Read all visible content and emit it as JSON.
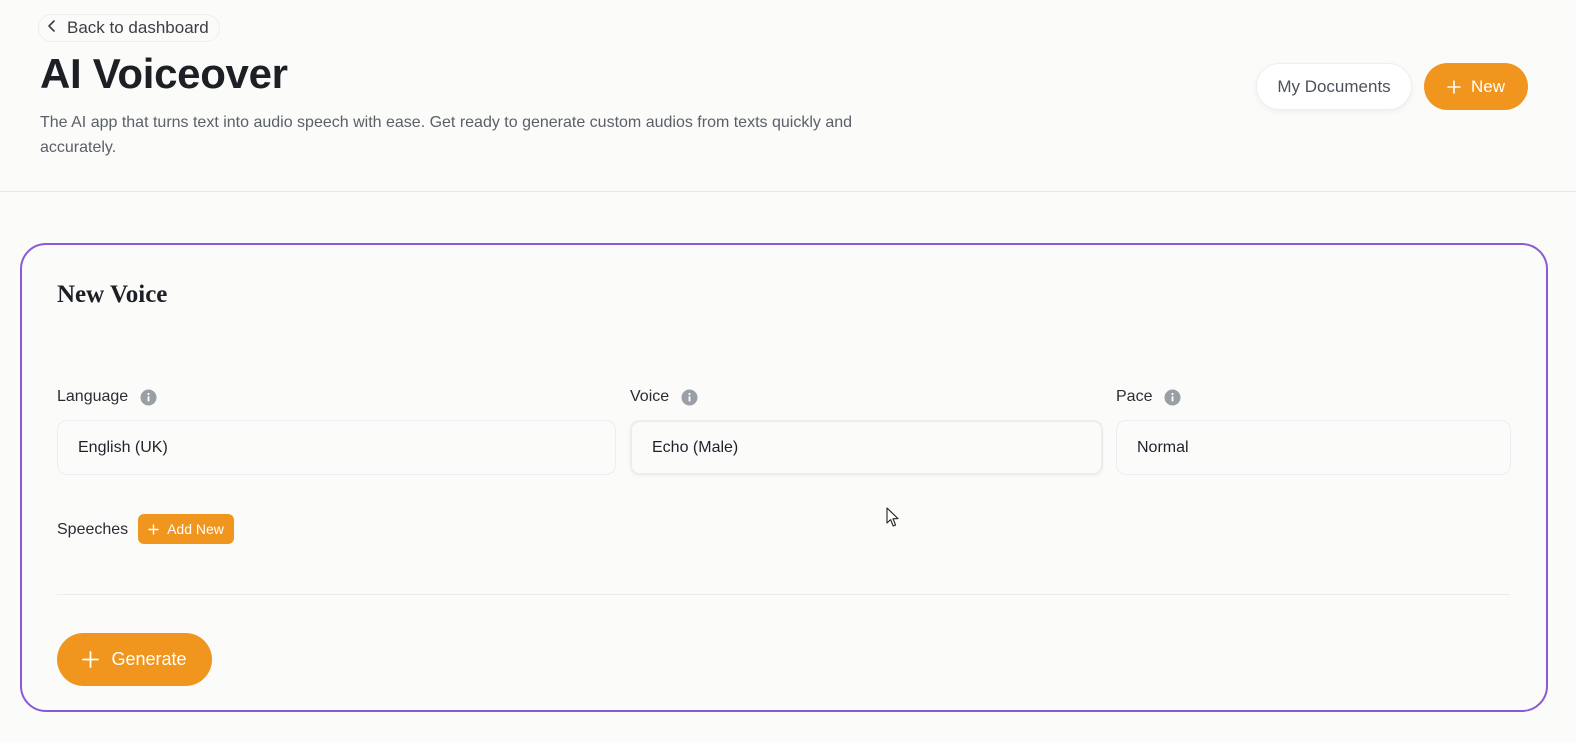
{
  "header": {
    "back_label": "Back to dashboard",
    "title": "AI Voiceover",
    "description": "The AI app that turns text into audio speech with ease. Get ready to generate custom audios from texts quickly and accurately.",
    "my_documents_label": "My Documents",
    "new_label": "New"
  },
  "form": {
    "title": "New Voice",
    "fields": [
      {
        "label": "Language",
        "value": "English (UK)",
        "icon": "info-icon"
      },
      {
        "label": "Voice",
        "value": "Echo (Male)",
        "icon": "info-icon"
      },
      {
        "label": "Pace",
        "value": "Normal",
        "icon": "info-icon"
      }
    ],
    "speeches_label": "Speeches",
    "add_new_label": "Add New",
    "generate_label": "Generate"
  },
  "colors": {
    "accent": "#f0961f",
    "card_border": "#8a5ad6",
    "text_primary": "#1c1f24",
    "text_muted": "#5b6068"
  },
  "icons": [
    "chevron-left-icon",
    "plus-icon",
    "info-icon",
    "mouse-cursor-icon"
  ]
}
